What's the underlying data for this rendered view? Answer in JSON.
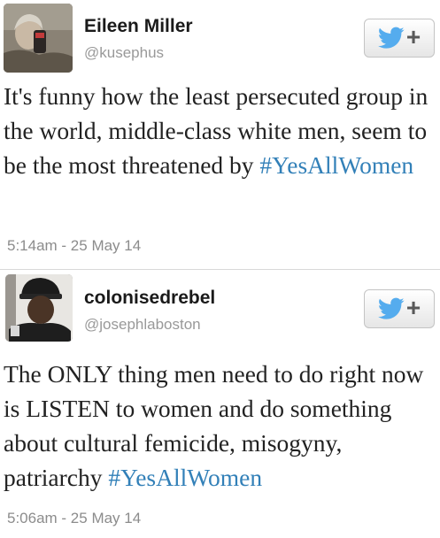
{
  "tweets": [
    {
      "name": "Eileen Miller",
      "handle": "@kusephus",
      "text": "It's funny how the least persecuted group in the world, middle-class white men, seem to be the most threatened by",
      "hashtag": "#YesAllWomen",
      "timestamp": "5:14am - 25 May 14",
      "follow_icon": "twitter-bird-plus-icon"
    },
    {
      "name": "colonisedrebel",
      "handle": "@josephlaboston",
      "text": "The ONLY thing men need to do right now is LISTEN to women and do something about cultural femicide, misogyny, patriarchy",
      "hashtag": "#YesAllWomen",
      "timestamp": "5:06am - 25 May 14",
      "follow_icon": "twitter-bird-plus-icon"
    }
  ],
  "follow_plus": "+",
  "colors": {
    "hashtag": "#3280b8",
    "bird": "#55acee",
    "timestamp": "#8c8c8c"
  }
}
